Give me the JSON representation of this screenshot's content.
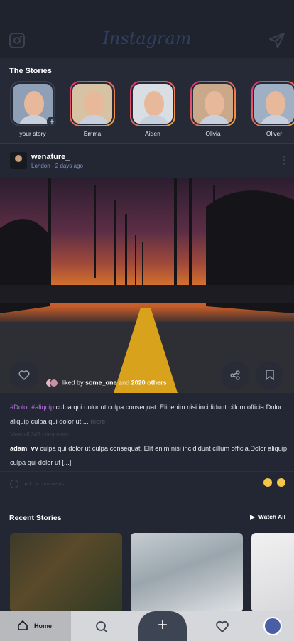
{
  "header": {
    "logo_text": "Instagram"
  },
  "stories": {
    "title": "The Stories",
    "items": [
      {
        "label": "your story"
      },
      {
        "label": "Emma"
      },
      {
        "label": "Aiden"
      },
      {
        "label": "Olivia"
      },
      {
        "label": "Oliver"
      }
    ]
  },
  "post": {
    "username": "wenature_",
    "meta": "London - 2 days ago",
    "liked_by_prefix": "liked by",
    "liked_by_user": "some_one",
    "liked_by_and": "and",
    "liked_by_others": "2020 others",
    "caption_tags": "#Dolor #aliquip",
    "caption_text": "culpa qui dolor ut culpa consequat. Elit enim nisi incididunt cillum officia.Dolor aliquip culpa qui dolor ut ...",
    "caption_more": "more",
    "view_all_comments": "View all 343 comments",
    "comment_user": "adam_vv",
    "comment_text": "culpa qui dolor ut culpa consequat. Elit enim nisi incididunt cillum officia.Dolor aliquip culpa qui dolor ut [...]",
    "add_comment_placeholder": "Add a comments..."
  },
  "recent": {
    "title": "Recent Stories",
    "watch_all": "Watch All"
  },
  "tabbar": {
    "home_label": "Home"
  }
}
